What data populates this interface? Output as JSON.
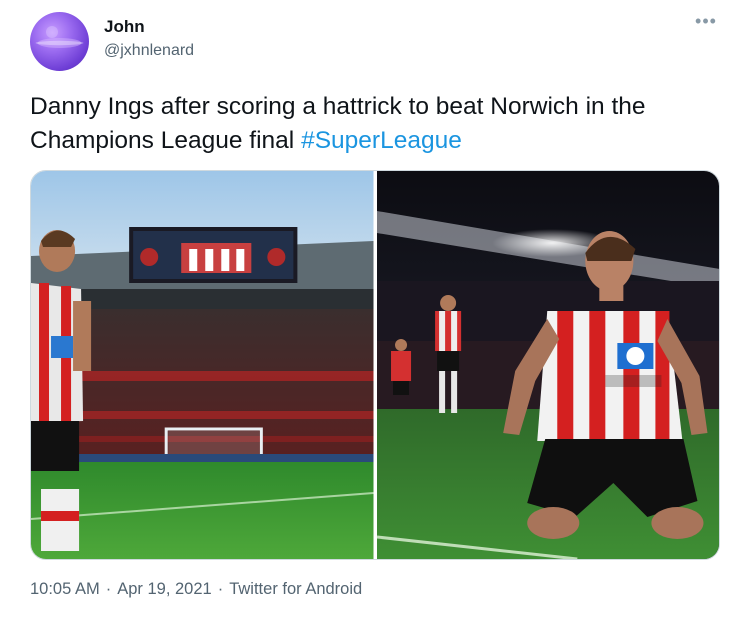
{
  "user": {
    "name": "John",
    "handle": "@jxhnlenard"
  },
  "tweet": {
    "text": "Danny Ings after scoring a hattrick to beat Norwich in the Champions League final",
    "hashtag": "#SuperLeague"
  },
  "meta": {
    "time": "10:05 AM",
    "date": "Apr 19, 2021",
    "source": "Twitter for Android"
  },
  "icons": {
    "more": "more-horizontal-icon"
  },
  "colors": {
    "hashtag": "#1b95e0",
    "secondary_text": "#536471"
  }
}
